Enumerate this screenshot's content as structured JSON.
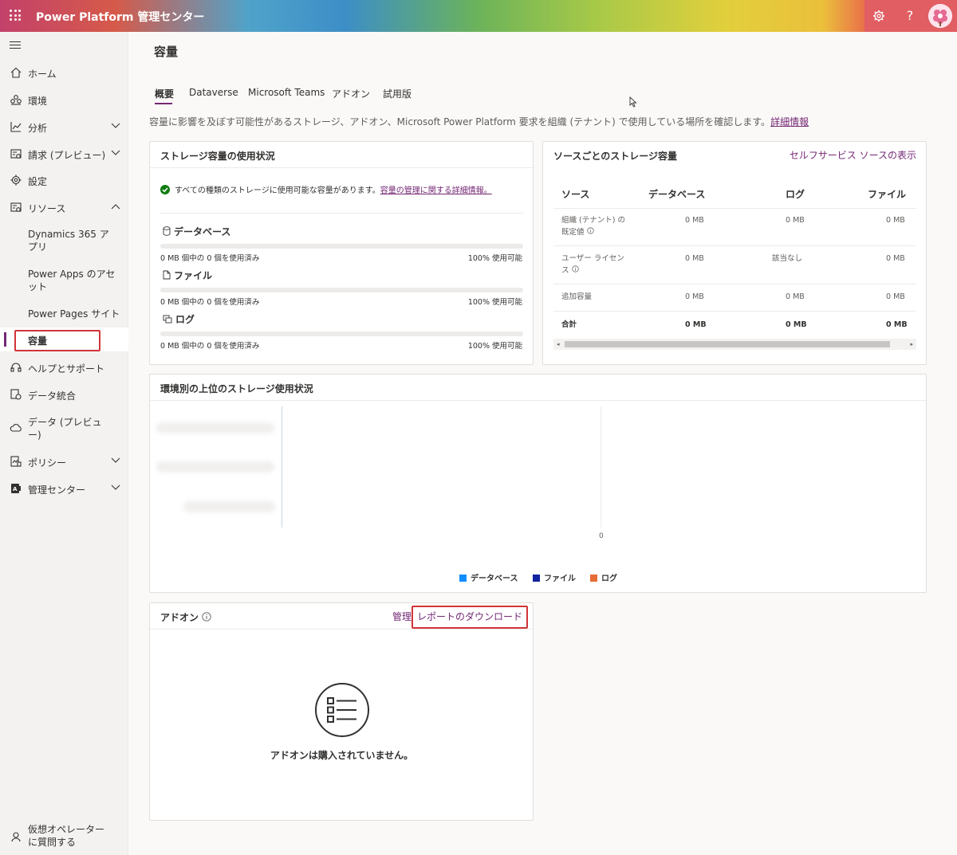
{
  "header": {
    "app_title": "Power Platform 管理センター"
  },
  "sidebar": {
    "items": [
      {
        "label": "ホーム"
      },
      {
        "label": "環境"
      },
      {
        "label": "分析"
      },
      {
        "label": "請求 (プレビュー)"
      },
      {
        "label": "設定"
      },
      {
        "label": "リソース"
      },
      {
        "label": "Dynamics 365 アプリ"
      },
      {
        "label": "Power Apps のアセット"
      },
      {
        "label": "Power Pages サイト"
      },
      {
        "label": "容量"
      },
      {
        "label": "ヘルプとサポート"
      },
      {
        "label": "データ統合"
      },
      {
        "label": "データ (プレビュー)"
      },
      {
        "label": "ポリシー"
      },
      {
        "label": "管理センター"
      }
    ],
    "virtual_agent": "仮想オペレーターに質問する"
  },
  "page": {
    "title": "容量",
    "tabs": [
      "概要",
      "Dataverse",
      "Microsoft Teams",
      "アドオン",
      "試用版"
    ],
    "description": "容量に影響を及ぼす可能性があるストレージ、アドオン、Microsoft Power Platform 要求を組織 (テナント) で使用している場所を確認します。",
    "description_link": "詳細情報"
  },
  "storage_card": {
    "title": "ストレージ容量の使用状況",
    "status_text": "すべての種類のストレージに使用可能な容量があります。",
    "status_link": "容量の管理に関する詳細情報。",
    "sections": [
      {
        "name": "データベース",
        "used_text": "0 MB 個中の 0 個を使用済み",
        "available_text": "100% 使用可能",
        "used_fraction": 0
      },
      {
        "name": "ファイル",
        "used_text": "0 MB 個中の 0 個を使用済み",
        "available_text": "100% 使用可能",
        "used_fraction": 0
      },
      {
        "name": "ログ",
        "used_text": "0 MB 個中の 0 個を使用済み",
        "available_text": "100% 使用可能",
        "used_fraction": 0
      }
    ]
  },
  "source_card": {
    "title": "ソースごとのストレージ容量",
    "link": "セルフサービス ソースの表示",
    "columns": [
      "ソース",
      "データベース",
      "ログ",
      "ファイル"
    ],
    "rows": [
      {
        "source_l1": "組織 (テナント) の",
        "source_l2": "既定値",
        "db": "0 MB",
        "log": "0 MB",
        "file": "0 MB"
      },
      {
        "source_l1": "ユーザー ライセン",
        "source_l2": "ス",
        "db": "0 MB",
        "log": "該当なし",
        "file": "0 MB"
      },
      {
        "source_l1": "追加容量",
        "source_l2": "",
        "db": "0 MB",
        "log": "0 MB",
        "file": "0 MB"
      },
      {
        "source_l1": "合計",
        "source_l2": "",
        "db": "0 MB",
        "log": "0 MB",
        "file": "0 MB"
      }
    ]
  },
  "env_card": {
    "title": "環境別の上位のストレージ使用状況",
    "axis_zero": "0",
    "legend": [
      {
        "label": "データベース",
        "color": "#118dff"
      },
      {
        "label": "ファイル",
        "color": "#12239e"
      },
      {
        "label": "ログ",
        "color": "#e66c37"
      }
    ]
  },
  "addon_card": {
    "title": "アドオン",
    "manage_link": "管理",
    "download_link": "レポートのダウンロード",
    "empty_text": "アドオンは購入されていません。"
  },
  "colors": {
    "accent": "#742774",
    "highlight_box": "#d13438",
    "success": "#107c10"
  }
}
